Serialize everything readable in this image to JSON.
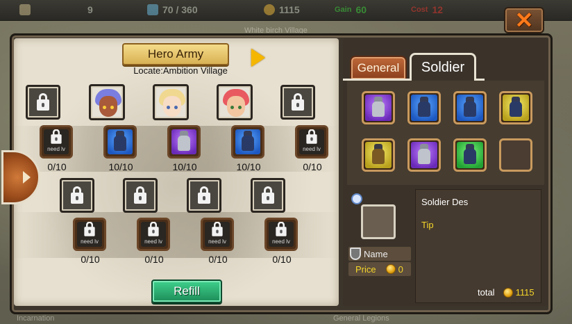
{
  "topbar": {
    "time_value": "9",
    "population": "70 / 360",
    "gold": "1115",
    "gain_label": "Gain",
    "gain_value": "60",
    "cost_label": "Cost",
    "cost_value": "12"
  },
  "background": {
    "village_label": "White birch Village",
    "bottom_left": "Incarnation",
    "bottom_mid": "General Legions"
  },
  "close_button": {
    "label": "✕"
  },
  "army": {
    "title": "Hero Army",
    "locate": "Locate:Ambition Village"
  },
  "row2_counts": [
    "0/10",
    "10/10",
    "10/10",
    "10/10",
    "0/10"
  ],
  "row4_counts": [
    "0/10",
    "0/10",
    "0/10",
    "0/10"
  ],
  "need_lv": "need lv",
  "refill_label": "Refill",
  "tabs": {
    "general": "General",
    "soldier": "Soldier"
  },
  "detail": {
    "name_label": "Name",
    "price_label": "Price",
    "price_value": "0",
    "description": "Soldier Des",
    "tip": "Tip",
    "total_label": "total",
    "total_value": "1115"
  },
  "colors": {
    "accent_gold": "#f5d62a",
    "refill_green": "#2fb074",
    "close_orange": "#ff7a1a"
  }
}
